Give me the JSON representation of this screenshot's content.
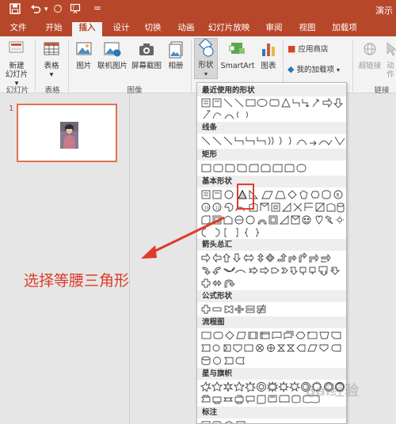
{
  "titlebar": {
    "title": "演示",
    "icons": [
      "save-icon",
      "undo-icon",
      "redo-icon",
      "present-from-start-icon",
      "customize-quick-access-icon"
    ]
  },
  "tabs": [
    {
      "label": "文件",
      "active": false
    },
    {
      "label": "开始",
      "active": false
    },
    {
      "label": "插入",
      "active": true
    },
    {
      "label": "设计",
      "active": false
    },
    {
      "label": "切换",
      "active": false
    },
    {
      "label": "动画",
      "active": false
    },
    {
      "label": "幻灯片放映",
      "active": false
    },
    {
      "label": "审阅",
      "active": false
    },
    {
      "label": "视图",
      "active": false
    },
    {
      "label": "加载项",
      "active": false
    }
  ],
  "ribbon": {
    "new_slide": "新建\n幻灯片",
    "new_slide_line1": "新建",
    "new_slide_line2": "幻灯片 ▾",
    "table": "表格",
    "table_arrow": "▾",
    "picture": "图片",
    "online_picture": "联机图片",
    "screenshot": "屏幕截图",
    "album": "相册",
    "shapes": "形状",
    "smartart": "SmartArt",
    "chart": "图表",
    "store": "应用商店",
    "my_addins": "我的加载项",
    "hyperlink": "超链接",
    "action": "动作",
    "groups": {
      "slides": "幻灯片",
      "tables": "表格",
      "images": "图像",
      "links": "链接"
    }
  },
  "slides_pane": {
    "slide_number": "1"
  },
  "annotation": {
    "text": "选择等腰三角形"
  },
  "shapes_menu": {
    "sections": [
      "最近使用的形状",
      "线条",
      "矩形",
      "基本形状",
      "箭头总汇",
      "公式形状",
      "流程图",
      "星与旗帜",
      "标注"
    ],
    "highlighted_shape": "isosceles-triangle"
  },
  "watermark": "Bai经验",
  "colors": {
    "accent": "#b7472a",
    "highlight": "#e53a2a",
    "annotation": "#e03a2a"
  }
}
